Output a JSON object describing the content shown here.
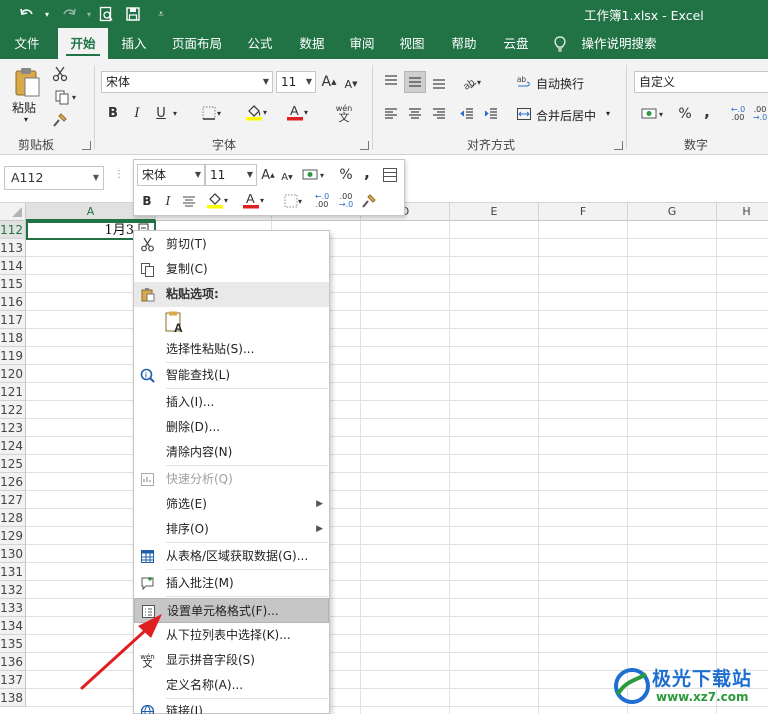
{
  "titlebar": {
    "title": "工作簿1.xlsx  -  Excel"
  },
  "tabs": [
    "文件",
    "开始",
    "插入",
    "页面布局",
    "公式",
    "数据",
    "审阅",
    "视图",
    "帮助",
    "云盘",
    "操作说明搜索"
  ],
  "ribbon": {
    "clipboard": {
      "paste": "粘贴",
      "label": "剪贴板"
    },
    "font": {
      "name": "宋体",
      "size": "11",
      "bold": "B",
      "italic": "I",
      "underline": "U",
      "label": "字体",
      "phonetic": "wén文"
    },
    "alignment": {
      "wrap": "自动换行",
      "merge": "合并后居中",
      "label": "对齐方式"
    },
    "number": {
      "format": "自定义",
      "percent": "%",
      "comma": ",",
      "label": "数字"
    }
  },
  "formula_bar": {
    "name_box": "A112"
  },
  "sheet": {
    "columns": [
      "A",
      "B",
      "C",
      "D",
      "E",
      "F",
      "G",
      "H"
    ],
    "rows": [
      "112",
      "113",
      "114",
      "115",
      "116",
      "117",
      "118",
      "119",
      "120",
      "121",
      "122",
      "123",
      "124",
      "125",
      "126",
      "127",
      "128",
      "129",
      "130",
      "131",
      "132",
      "133",
      "134",
      "135",
      "136",
      "137",
      "138"
    ],
    "active_cell_value": "1月3"
  },
  "mini_toolbar": {
    "font": "宋体",
    "size": "11",
    "bold": "B",
    "italic": "I",
    "percent": "%",
    "comma": ","
  },
  "context_menu": {
    "cut": "剪切(T)",
    "copy": "复制(C)",
    "paste_options": "粘贴选项:",
    "paste_special": "选择性粘贴(S)...",
    "smart_lookup": "智能查找(L)",
    "insert": "插入(I)...",
    "delete": "删除(D)...",
    "clear": "清除内容(N)",
    "quick_analysis": "快速分析(Q)",
    "filter": "筛选(E)",
    "sort": "排序(O)",
    "from_table": "从表格/区域获取数据(G)...",
    "insert_comment": "插入批注(M)",
    "format_cells": "设置单元格格式(F)...",
    "pick_list": "从下拉列表中选择(K)...",
    "phonetic": "显示拼音字段(S)",
    "define_name": "定义名称(A)...",
    "link": "链接(I)"
  },
  "watermark": {
    "brand": "极光下载站",
    "url": "www.xz7.com"
  },
  "colors": {
    "accent": "#217346",
    "arrow": "#e02020"
  }
}
